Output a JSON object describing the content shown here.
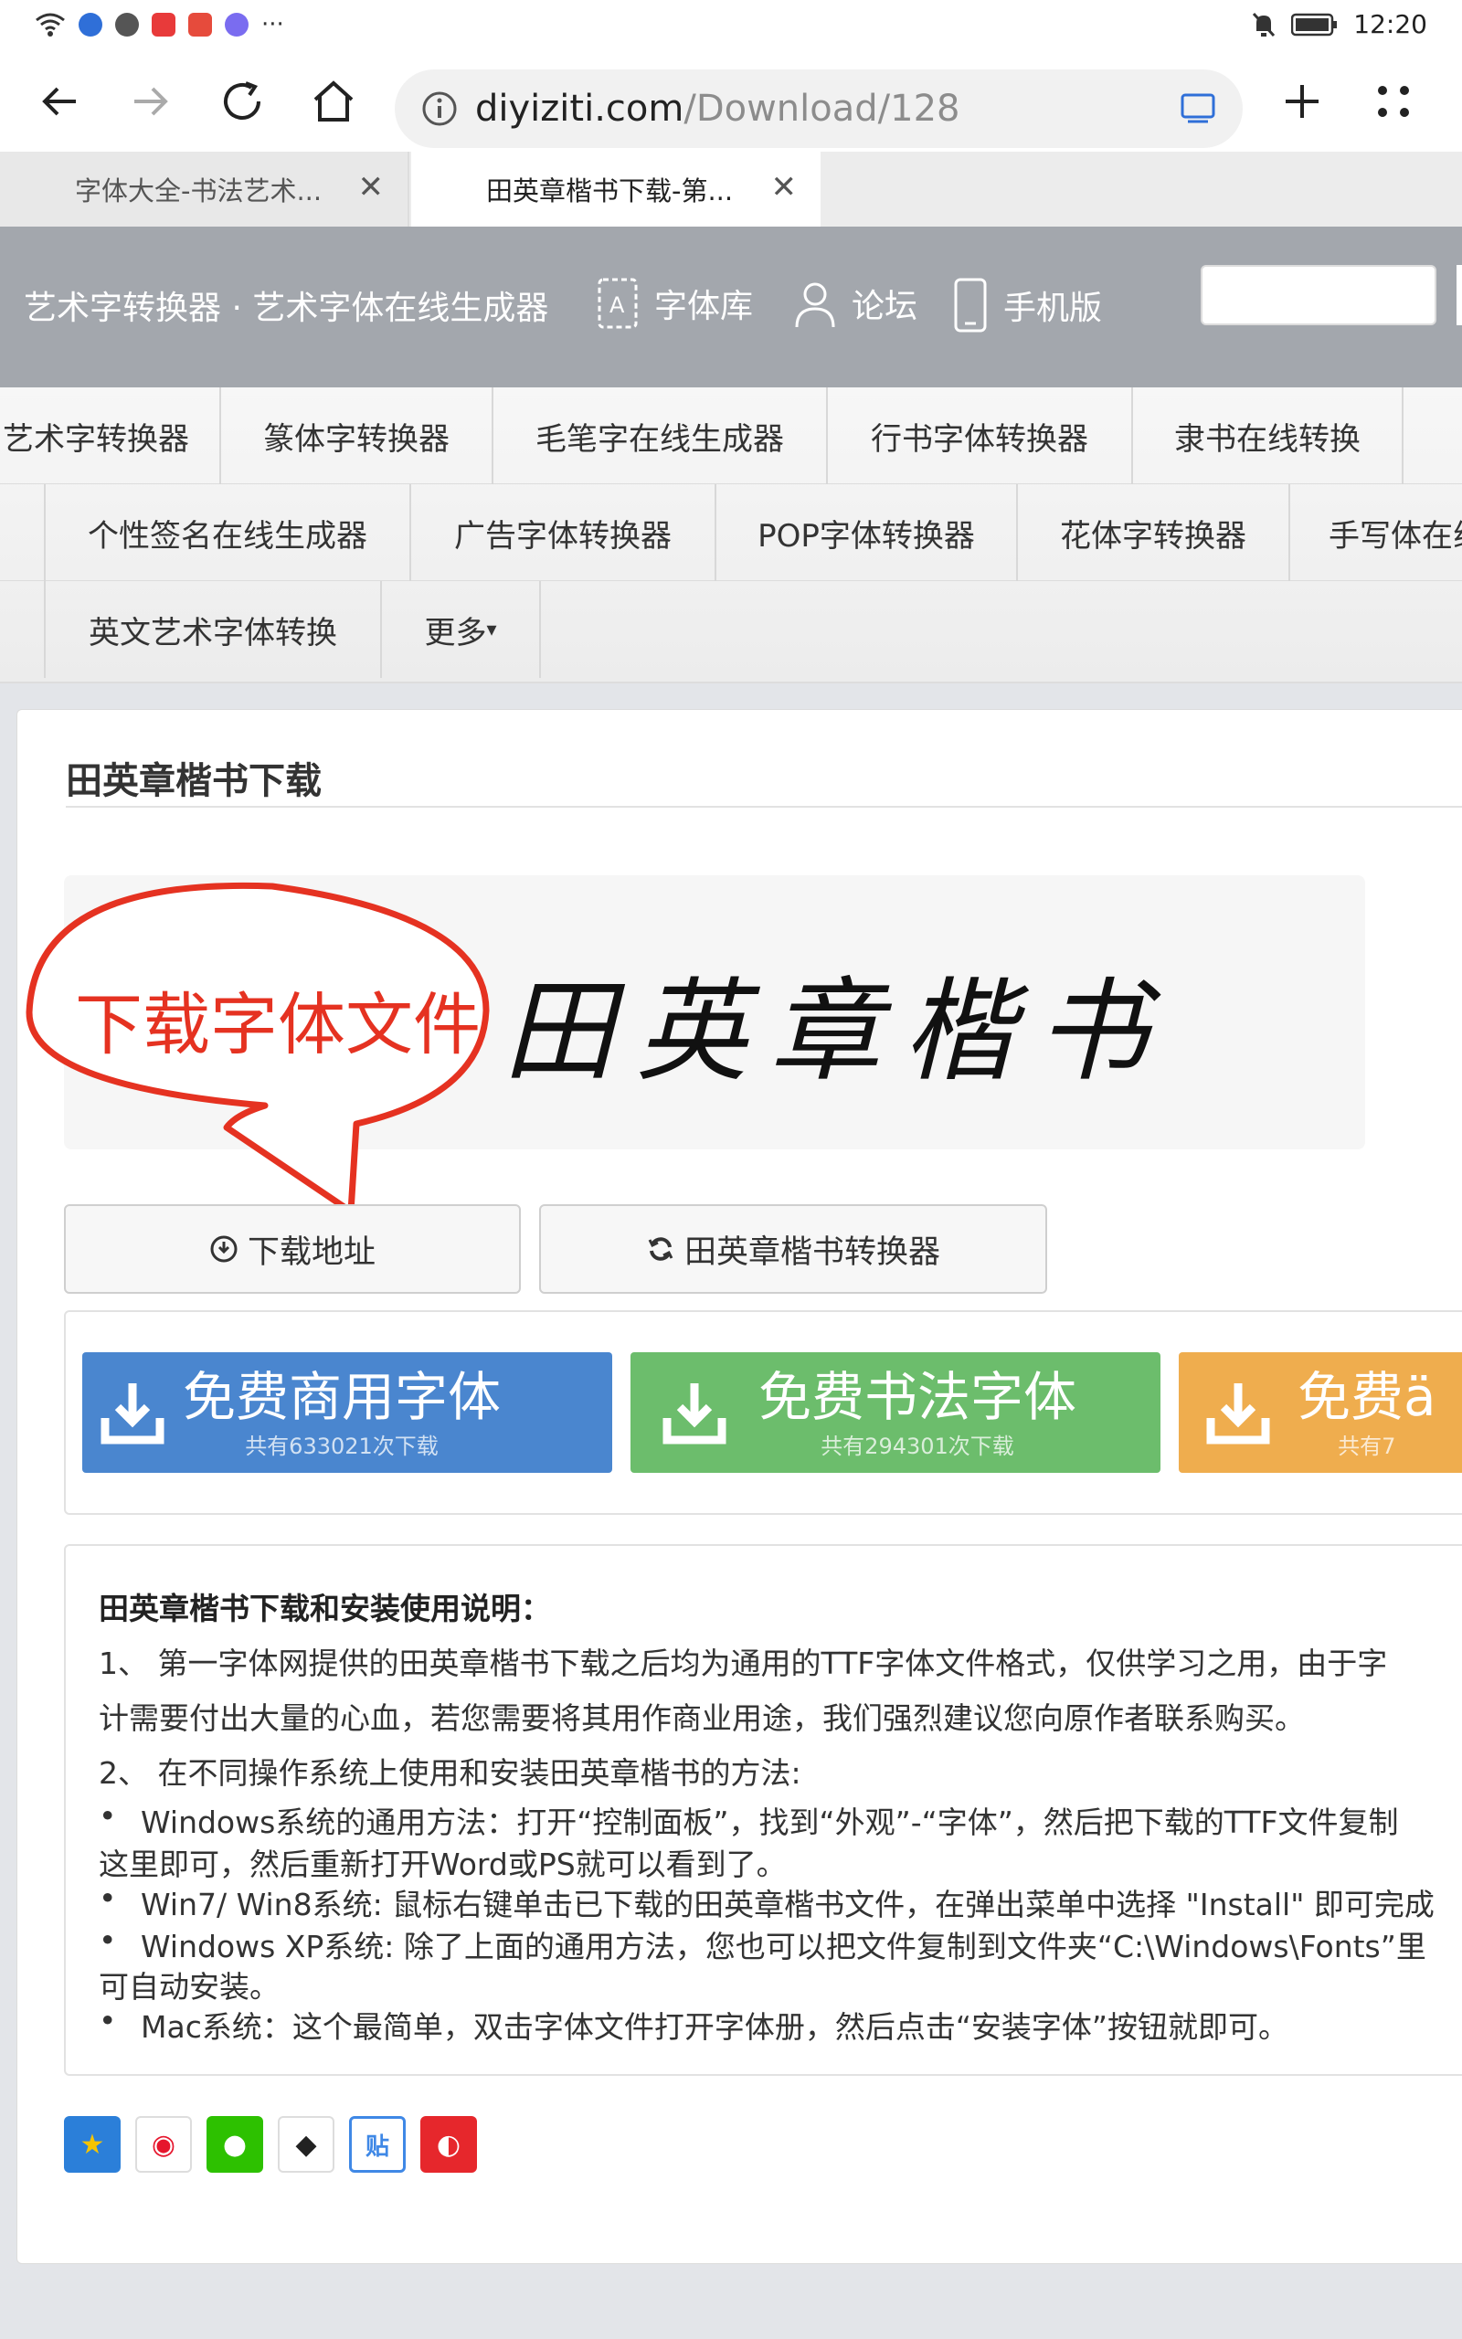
{
  "status_bar": {
    "time": "12:20",
    "icons": [
      "wifi-icon",
      "bulb-icon",
      "vpn-icon",
      "app-red-icon",
      "app-store-icon",
      "music-icon",
      "more-dots-icon",
      "mute-icon",
      "battery-icon"
    ],
    "more": "···"
  },
  "toolbar": {
    "url_domain": "diyiziti.com",
    "url_path": "/Download/128",
    "icons": [
      "back-icon",
      "forward-icon",
      "reload-icon",
      "home-icon",
      "info-icon",
      "tablet-mode-icon",
      "new-tab-icon",
      "menu-icon"
    ]
  },
  "tabs": [
    {
      "title": "字体大全-书法艺术...",
      "close": "✕"
    },
    {
      "title": "田英章楷书下载-第...",
      "close": "✕"
    }
  ],
  "site_header": {
    "brand": "艺术字转换器 · 艺术字体在线生成器",
    "nav": [
      "字体库",
      "论坛",
      "手机版"
    ]
  },
  "nav_menu": {
    "row1": [
      "艺术字转换器",
      "篆体字转换器",
      "毛笔字在线生成器",
      "行书字体转换器",
      "隶书在线转换"
    ],
    "row2": [
      "个性签名在线生成器",
      "广告字体转换器",
      "POP字体转换器",
      "花体字转换器",
      "手写体在线"
    ],
    "row3": [
      "英文艺术字体转换",
      "更多"
    ],
    "row3_suffix": "▾"
  },
  "main": {
    "title": "田英章楷书下载",
    "sample_text": "田英章楷书",
    "callout_text": "下载字体文件",
    "download_button": "下载地址",
    "converter_button": "田英章楷书转换器"
  },
  "ads": [
    {
      "title": "免费商用字体",
      "sub": "共有633021次下载",
      "color": "#4a86cf"
    },
    {
      "title": "免费书法字体",
      "sub": "共有294301次下载",
      "color": "#6cbd6c"
    },
    {
      "title": "免费ä",
      "sub": "共有7",
      "color": "#efad4e"
    }
  ],
  "instructions": {
    "title": "田英章楷书下载和安装使用说明：",
    "p1_line1": "1、 第一字体网提供的田英章楷书下载之后均为通用的TTF字体文件格式，仅供学习之用，由于字",
    "p1_line2": "计需要付出大量的心血，若您需要将其用作商业用途，我们强烈建议您向原作者联系购买。",
    "p2": "2、 在不同操作系统上使用和安装田英章楷书的方法:",
    "b1_line1": "Windows系统的通用方法：打开“控制面板”，找到“外观”-“字体”，然后把下载的TTF文件复制",
    "b1_line2": "这里即可，然后重新打开Word或PS就可以看到了。",
    "b2": "Win7/ Win8系统: 鼠标右键单击已下载的田英章楷书文件，在弹出菜单中选择 \"Install\" 即可完成",
    "b3_line1": "Windows XP系统: 除了上面的通用方法，您也可以把文件复制到文件夹“C:\\Windows\\Fonts”里",
    "b3_line2": "可自动安装。",
    "b4": "Mac系统：这个最简单，双击字体文件打开字体册，然后点击“安装字体”按钮就即可。"
  },
  "share": [
    {
      "name": "qzone-icon",
      "glyph": "★",
      "color": "#f5c400"
    },
    {
      "name": "weibo-icon",
      "glyph": "◉",
      "color": "#e6162d"
    },
    {
      "name": "wechat-icon",
      "glyph": "●",
      "color": "#2dc100"
    },
    {
      "name": "qq-icon",
      "glyph": "◆",
      "color": "#333333"
    },
    {
      "name": "tieba-icon",
      "glyph": "贴",
      "color": "#3f88e6"
    },
    {
      "name": "kaixin-icon",
      "glyph": "◐",
      "color": "#e6272c"
    }
  ]
}
